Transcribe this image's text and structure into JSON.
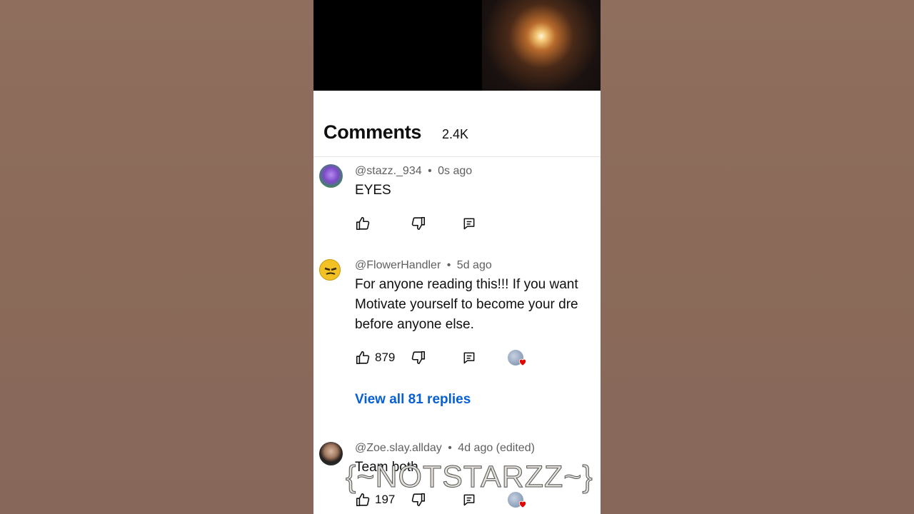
{
  "sheet": {
    "title": "Comments",
    "count": "2.4K"
  },
  "comments": [
    {
      "handle": "@stazz._934",
      "time": "0s ago",
      "lines": [
        "EYES"
      ],
      "likes": "",
      "has_heart": false
    },
    {
      "handle": "@FlowerHandler",
      "time": "5d ago",
      "lines": [
        "For anyone reading this!!! If you want",
        "Motivate yourself to become your dre",
        "before anyone else."
      ],
      "likes": "879",
      "has_heart": true,
      "view_replies": "View all 81 replies"
    },
    {
      "handle": "@Zoe.slay.allday",
      "time": "4d ago (edited)",
      "lines": [
        "Team both"
      ],
      "likes": "197",
      "has_heart": true
    }
  ],
  "separator": "•",
  "watermark": "{~NOTSTARZZ~}",
  "colors": {
    "link": "#065fd4",
    "text": "#0f0f0f",
    "meta": "#606060",
    "heart": "#e10600"
  }
}
